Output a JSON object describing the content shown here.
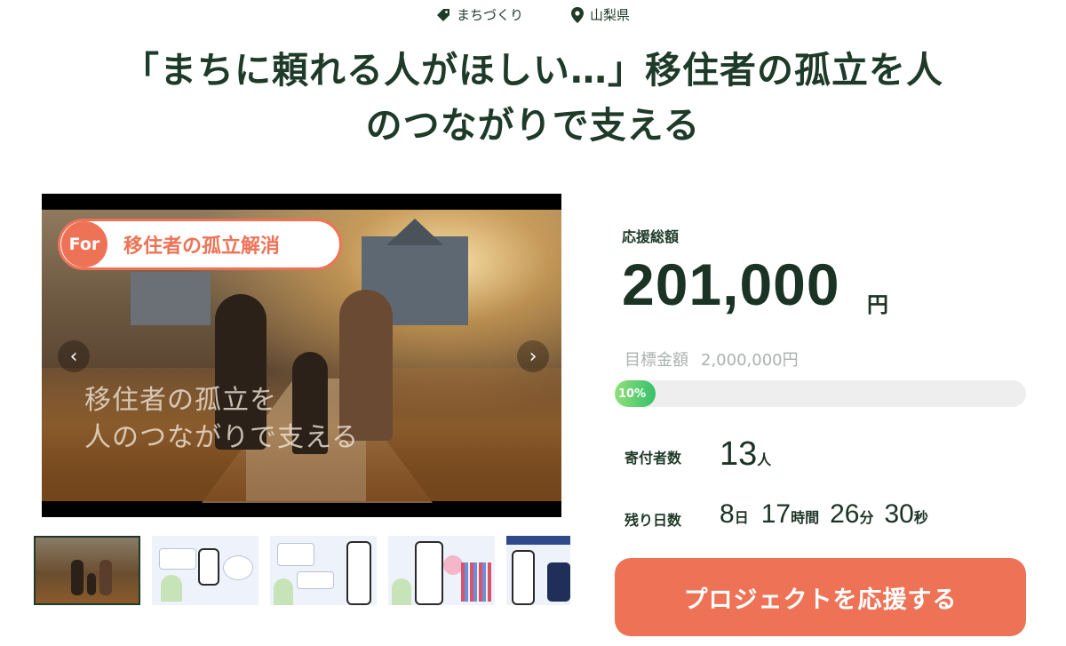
{
  "tags": [
    {
      "icon": "tag-icon",
      "label": "まちづくり"
    },
    {
      "icon": "location-pin-icon",
      "label": "山梨県"
    }
  ],
  "title_line1": "「まちに頼れる人がほしい…」移住者の孤立を人",
  "title_line2": "のつながりで支える",
  "media": {
    "badge_prefix": "For",
    "badge_text": "移住者の孤立解消",
    "overlay_line1": "移住者の孤立を",
    "overlay_line2": "人のつながりで支える",
    "prev_glyph": "‹",
    "next_glyph": "›",
    "thumbnail_count": 5,
    "active_thumbnail": 1
  },
  "funding": {
    "total_label": "応援総額",
    "total_amount": "201,000",
    "total_unit": "円",
    "goal_label": "目標金額",
    "goal_amount": "2,000,000円",
    "progress_percent": 10,
    "progress_label": "10%",
    "supporters_label": "寄付者数",
    "supporters_count": "13",
    "supporters_unit": "人",
    "remaining_label": "残り日数",
    "days": "8",
    "days_unit": "日",
    "hours": "17",
    "hours_unit": "時間",
    "minutes": "26",
    "minutes_unit": "分",
    "seconds": "30",
    "seconds_unit": "秒"
  },
  "cta_label": "プロジェクトを応援する",
  "colors": {
    "accent": "#ee7356",
    "text": "#1e3a28",
    "progress": "#37c06b",
    "muted": "#a9b2ad"
  }
}
